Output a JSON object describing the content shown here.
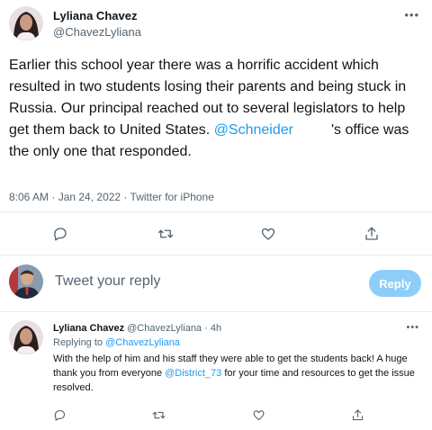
{
  "tweet": {
    "author_name": "Lyliana Chavez",
    "author_handle": "@ChavezLyliana",
    "more_icon": "•••",
    "text_part1": "Earlier this school year there was a horrific accident which resulted in two students losing their parents and being stuck in Russia. Our principal reached out to several legislators to help get them back to United States. ",
    "mention": "@Schneider",
    "text_part2": "'s office was the only one that responded.",
    "timestamp": "8:06 AM · Jan 24, 2022 · Twitter for iPhone",
    "actions": [
      "reply-icon",
      "retweet-icon",
      "like-icon",
      "share-icon"
    ]
  },
  "reply_box": {
    "placeholder": "Tweet your reply",
    "button_label": "Reply"
  },
  "reply": {
    "author_name": "Lyliana Chavez",
    "author_handle_time": " @ChavezLyliana · 4h",
    "replying_prefix": "Replying to ",
    "replying_to": "@ChavezLyliana",
    "text_part1": "With the help of him and his staff they were able to get the students back! A huge thank you from everyone ",
    "mention": "@District_73",
    "text_part2": " for your time and resources to get the issue resolved.",
    "more_icon": "•••"
  },
  "colors": {
    "accent": "#1d9bf0",
    "reply_button": "#8ecdf8",
    "secondary_text": "#536471",
    "divider": "#e6ecf0"
  }
}
